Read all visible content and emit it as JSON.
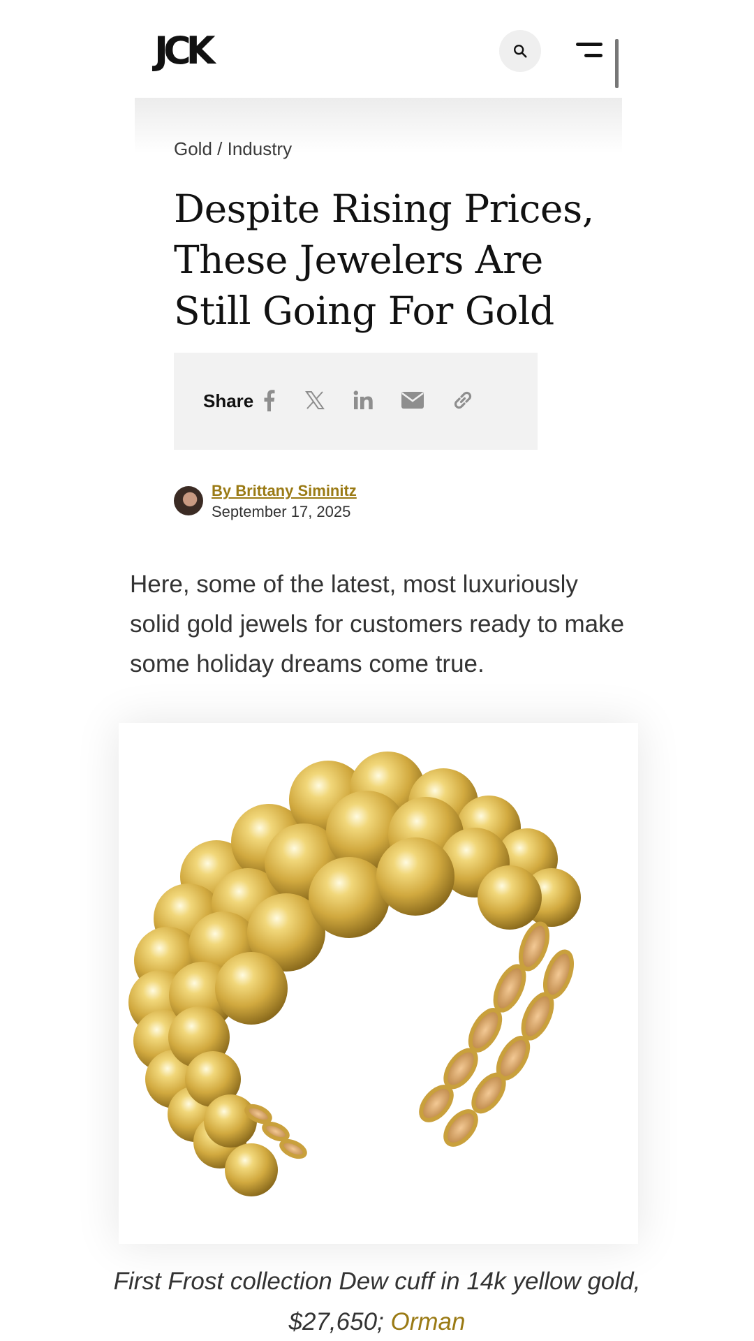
{
  "header": {
    "logo": "JCK",
    "search_icon": "search-icon",
    "menu_icon": "menu-icon"
  },
  "article": {
    "breadcrumb": {
      "primary": "Gold",
      "separator": " / ",
      "secondary": "Industry"
    },
    "headline": "Despite Rising Prices, These Jewelers Are Still Going For Gold",
    "share": {
      "label": "Share",
      "icons": [
        "facebook-icon",
        "x-icon",
        "linkedin-icon",
        "email-icon",
        "link-icon"
      ]
    },
    "author": {
      "name": "By Brittany Siminitz",
      "date": "September 17, 2025"
    },
    "lede": "Here, some of the latest, most luxuriously solid gold jewels for customers ready to make some holiday dreams come true.",
    "figure": {
      "caption_text": "First Frost collection Dew cuff in 14k yellow gold, $27,650; ",
      "caption_link": "Orman"
    }
  },
  "colors": {
    "accent": "#9a7a14",
    "text": "#333333",
    "share_bg": "#f2f2f2",
    "gold": "#d9b548"
  }
}
